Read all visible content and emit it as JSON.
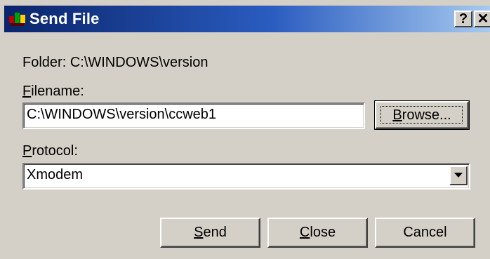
{
  "window": {
    "title": "Send File",
    "help_label": "?",
    "close_label": "✕"
  },
  "folder": {
    "label": "Folder:",
    "path": "C:\\WINDOWS\\version"
  },
  "filename": {
    "label_first": "F",
    "label_rest": "ilename:",
    "value": "C:\\WINDOWS\\version\\ccweb1",
    "browse_first": "B",
    "browse_rest": "rowse..."
  },
  "protocol": {
    "label_first": "P",
    "label_rest": "rotocol:",
    "selected": "Xmodem"
  },
  "buttons": {
    "send_first": "S",
    "send_rest": "end",
    "close_first": "C",
    "close_rest": "lose",
    "cancel": "Cancel"
  },
  "icons": [
    "app-icon",
    "help-icon",
    "close-icon",
    "dropdown-arrow-icon"
  ]
}
